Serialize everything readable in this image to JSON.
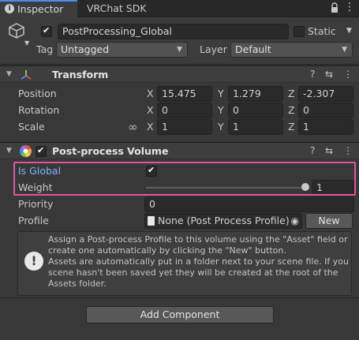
{
  "tabs": {
    "inspector_label": "Inspector",
    "vrchat_sdk_label": "VRChat SDK"
  },
  "icons": {
    "info": "i",
    "lock": "🔒",
    "more": "⋮",
    "cube": "⬡",
    "help": "?",
    "presets": "⇆",
    "link": "∞",
    "alert": "!",
    "target": "◉",
    "file": "▤"
  },
  "gameobject": {
    "active": true,
    "name": "PostProcessing_Global",
    "static_label": "Static",
    "static": false,
    "tag_label": "Tag",
    "tag_value": "Untagged",
    "layer_label": "Layer",
    "layer_value": "Default"
  },
  "transform": {
    "title": "Transform",
    "position_label": "Position",
    "rotation_label": "Rotation",
    "scale_label": "Scale",
    "x_axis": "X",
    "y_axis": "Y",
    "z_axis": "Z",
    "position": {
      "x": "15.475",
      "y": "1.279",
      "z": "-2.307"
    },
    "rotation": {
      "x": "0",
      "y": "0",
      "z": "0"
    },
    "scale": {
      "x": "1",
      "y": "1",
      "z": "1"
    }
  },
  "post_process_volume": {
    "enabled": true,
    "title": "Post-process Volume",
    "is_global_label": "Is Global",
    "is_global": true,
    "weight_label": "Weight",
    "weight_value": "1",
    "weight_fraction": 1.0,
    "priority_label": "Priority",
    "priority_value": "0",
    "profile_label": "Profile",
    "profile_value": "None (Post Process Profile)",
    "new_button_label": "New",
    "help_text": "Assign a Post-process Profile to this volume using the \"Asset\" field or create one automatically by clicking the \"New\" button.\nAssets are automatically put in a folder next to your scene file. If you scene hasn't been saved yet they will be created at the root of the Assets folder."
  },
  "footer": {
    "add_component_label": "Add Component"
  },
  "colors": {
    "accent": "#4a8df0",
    "highlight": "#e2559c",
    "is_global_label": "#7ab3ff"
  }
}
